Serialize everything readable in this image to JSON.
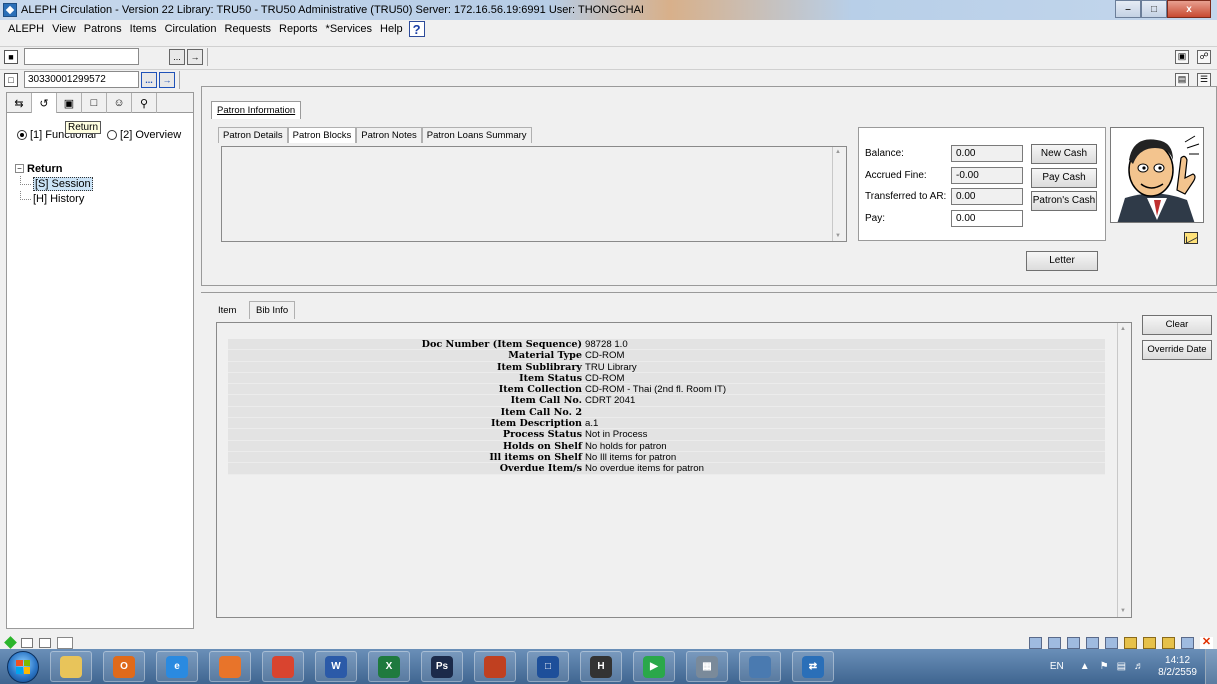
{
  "window": {
    "title": "ALEPH Circulation - Version 22  Library:  TRU50 - TRU50 Administrative (TRU50)  Server:  172.16.56.19:6991  User:  THONGCHAI",
    "min_label": "–",
    "max_label": "□",
    "close_label": "x"
  },
  "menu": {
    "items": [
      "ALEPH",
      "View",
      "Patrons",
      "Items",
      "Circulation",
      "Requests",
      "Reports",
      "*Services",
      "Help"
    ],
    "help_icon": "?"
  },
  "toolbar": {
    "patron_field_value": "",
    "item_barcode_value": "30330001299572",
    "browse_label": "...",
    "go_label": "→"
  },
  "left_panel": {
    "tooltip": "Return",
    "radio_functional": "[1] Functional",
    "radio_overview": "[2] Overview",
    "tree": {
      "root": "Return",
      "children": [
        "[S] Session",
        "[H] History"
      ]
    }
  },
  "patron": {
    "main_tab": "Patron Information",
    "sub_tabs": [
      "Patron Details",
      "Patron Blocks",
      "Patron Notes",
      "Patron Loans Summary"
    ],
    "active_sub_tab": "Patron Blocks",
    "cash": {
      "balance_label": "Balance:",
      "balance_value": "0.00",
      "accrued_label": "Accrued Fine:",
      "accrued_value": "-0.00",
      "transferred_label": "Transferred to AR:",
      "transferred_value": "0.00",
      "pay_label": "Pay:",
      "pay_value": "0.00"
    },
    "buttons": {
      "new_cash": "New Cash",
      "pay_cash": "Pay Cash",
      "patrons_cash": "Patron's Cash",
      "letter": "Letter"
    }
  },
  "item": {
    "tabs": [
      "Item",
      "Bib Info"
    ],
    "rows": [
      {
        "label": "Doc Number (Item Sequence)",
        "value": "98728 1.0"
      },
      {
        "label": "Material Type",
        "value": "CD-ROM"
      },
      {
        "label": "Item Sublibrary",
        "value": "TRU Library"
      },
      {
        "label": "Item Status",
        "value": "CD-ROM"
      },
      {
        "label": "Item Collection",
        "value": "CD-ROM - Thai (2nd fl. Room IT)"
      },
      {
        "label": "Item Call No.",
        "value": "CDRT 2041"
      },
      {
        "label": "Item Call No. 2",
        "value": ""
      },
      {
        "label": "Item Description",
        "value": "a.1"
      },
      {
        "label": "Process Status",
        "value": "Not in Process"
      },
      {
        "label": "Holds on Shelf",
        "value": "No holds for patron"
      },
      {
        "label": "Ill items on Shelf",
        "value": "No Ill items for patron"
      },
      {
        "label": "Overdue Item/s",
        "value": "No overdue items for patron"
      }
    ],
    "buttons": {
      "clear": "Clear",
      "override_date": "Override Date"
    }
  },
  "taskbar": {
    "lang": "EN",
    "time": "14:12",
    "date": "8/2/2559",
    "apps": [
      "file-explorer",
      "outlook",
      "internet-explorer",
      "firefox",
      "chrome",
      "word",
      "excel",
      "photoshop",
      "paint-app",
      "aleph-app",
      "hotmail-app",
      "media-player",
      "calculator",
      "book-app",
      "aleph-circulation"
    ]
  }
}
